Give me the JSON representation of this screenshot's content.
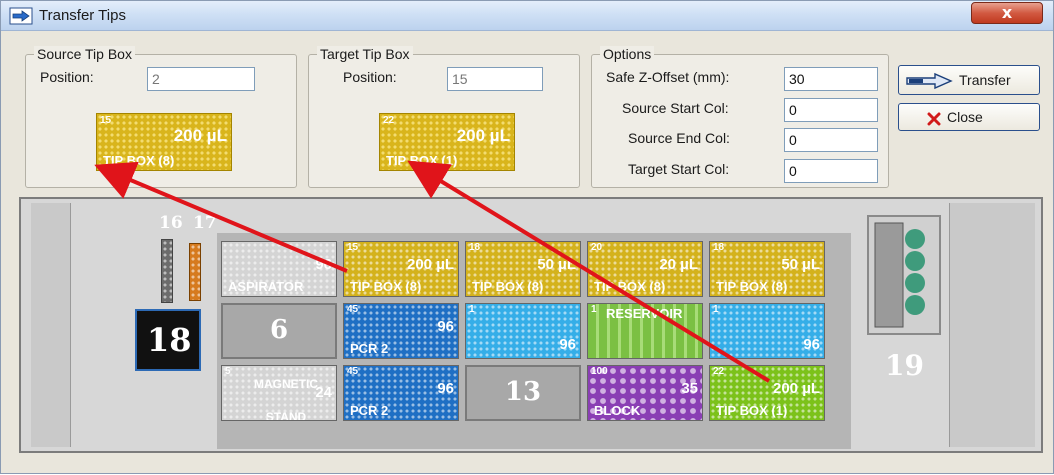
{
  "window": {
    "title": "Transfer Tips",
    "close_glyph": "x"
  },
  "source": {
    "legend": "Source Tip Box",
    "position_label": "Position:",
    "position_value": "2",
    "thumb": {
      "num": "15",
      "volume": "200 µL",
      "name": "TIP BOX (8)"
    }
  },
  "target": {
    "legend": "Target Tip Box",
    "position_label": "Position:",
    "position_value": "15",
    "thumb": {
      "num": "22",
      "volume": "200 µL",
      "name": "TIP BOX (1)"
    }
  },
  "options": {
    "legend": "Options",
    "safe_z_label": "Safe Z-Offset (mm):",
    "safe_z_value": "30",
    "src_start_label": "Source Start Col:",
    "src_start_value": "0",
    "src_end_label": "Source End Col:",
    "src_end_value": "0",
    "tgt_start_label": "Target Start Col:",
    "tgt_start_value": "0"
  },
  "buttons": {
    "transfer": "Transfer",
    "close": "Close"
  },
  "deck": {
    "pos16": "16",
    "pos17": "17",
    "pos18": "18",
    "pos19": "19",
    "labware": [
      {
        "num": "",
        "big": "96",
        "name": "ASPIRATOR",
        "color": "#d4d4d4"
      },
      {
        "num": "15",
        "big": "200 µL",
        "name": "TIP BOX (8)",
        "color": "#d4b21c"
      },
      {
        "num": "18",
        "big": "50 µL",
        "name": "TIP BOX (8)",
        "color": "#d4b21c"
      },
      {
        "num": "20",
        "big": "20 µL",
        "name": "TIP BOX (8)",
        "color": "#d4b21c"
      },
      {
        "num": "18",
        "big": "50 µL",
        "name": "TIP BOX (8)",
        "color": "#d4b21c"
      },
      {
        "num": "",
        "big": "6",
        "name": "",
        "color": "#a8a8a8"
      },
      {
        "num": "45",
        "big": "96",
        "name": "PCR 2",
        "color": "#1f6fc4"
      },
      {
        "num": "1",
        "big": "96",
        "name": "",
        "color": "#35aee8"
      },
      {
        "num": "1",
        "big": "RESERVOIR",
        "name": "",
        "color": "#7bc043"
      },
      {
        "num": "1",
        "big": "96",
        "name": "",
        "color": "#35aee8"
      },
      {
        "num": "5",
        "big": "24",
        "name": "MAGNETIC STAND",
        "color": "#d4d4d4"
      },
      {
        "num": "45",
        "big": "96",
        "name": "PCR 2",
        "color": "#1f6fc4"
      },
      {
        "num": "",
        "big": "13",
        "name": "",
        "color": "#a8a8a8"
      },
      {
        "num": "100",
        "big": "35",
        "name": "BLOCK",
        "color": "#8a3fb4"
      },
      {
        "num": "22",
        "big": "200 µL",
        "name": "TIP BOX (1)",
        "color": "#7cc21a"
      }
    ]
  },
  "colors": {
    "arrow": "#e0141a",
    "tip_yellow": "#d4b21c"
  }
}
